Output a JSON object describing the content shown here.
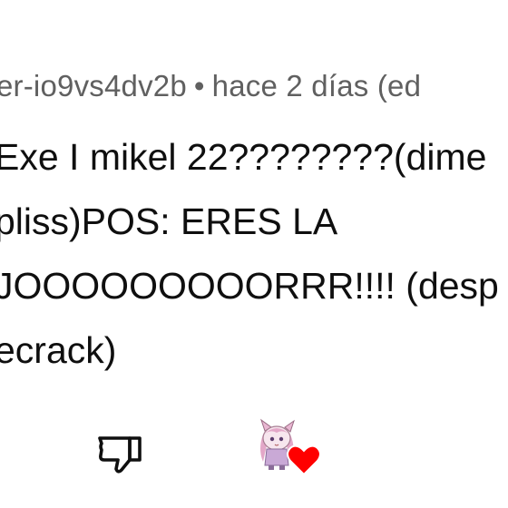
{
  "comment": {
    "author": "er-io9vs4dv2b",
    "separator": "•",
    "time": "hace 2 días (ed",
    "lines": [
      "Exe I mikel 22????????(dime",
      "pliss)POS: ERES LA",
      "JOOOOOOOOORRR!!!! (desp",
      "ecrack)"
    ]
  },
  "actions": {
    "dislike_icon": "thumbs-down-icon",
    "creator_heart_icon": "creator-heart-icon",
    "heart_color": "#ff0000"
  },
  "colors": {
    "meta_text": "#606060",
    "body_text": "#0f0f0f",
    "background": "#ffffff"
  }
}
